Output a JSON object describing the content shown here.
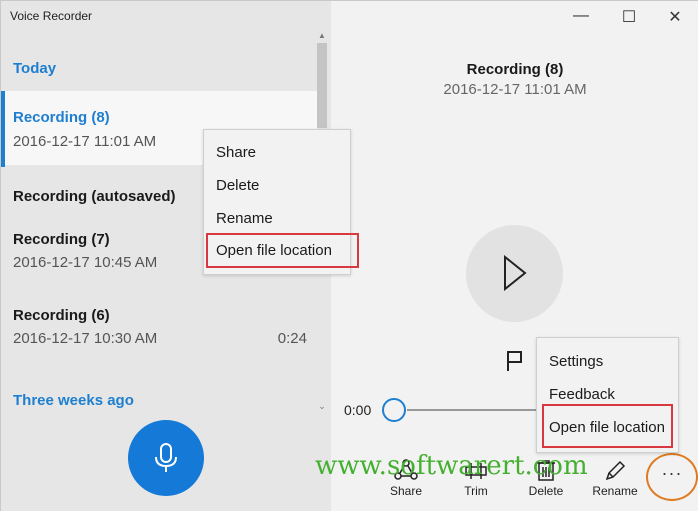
{
  "app": {
    "title": "Voice Recorder"
  },
  "list": {
    "groups": [
      {
        "header": "Today"
      },
      {
        "header": "Three weeks ago"
      }
    ],
    "items": [
      {
        "name": "Recording (8)",
        "date": "2016-12-17 11:01 AM",
        "duration": "",
        "selected": true
      },
      {
        "name": "Recording (autosaved)",
        "date": "",
        "duration": ""
      },
      {
        "name": "Recording (7)",
        "date": "2016-12-17 10:45 AM",
        "duration": ""
      },
      {
        "name": "Recording (6)",
        "date": "2016-12-17 10:30 AM",
        "duration": "0:24"
      }
    ]
  },
  "item_context_menu": {
    "items": [
      "Share",
      "Delete",
      "Rename",
      "Open file location"
    ],
    "highlighted": "Open file location"
  },
  "player": {
    "title": "Recording (8)",
    "date": "2016-12-17 11:01 AM",
    "position": "0:00"
  },
  "more_menu": {
    "items": [
      "Settings",
      "Feedback",
      "Open file location"
    ],
    "highlighted": "Open file location"
  },
  "toolbar": {
    "share": "Share",
    "trim": "Trim",
    "delete": "Delete",
    "rename": "Rename",
    "more": "···"
  },
  "watermark": "www.softwarert.com",
  "colors": {
    "accent": "#1e7fd0",
    "highlight_box": "#d9393e",
    "more_circle": "#e07b22",
    "watermark": "#44b030"
  }
}
